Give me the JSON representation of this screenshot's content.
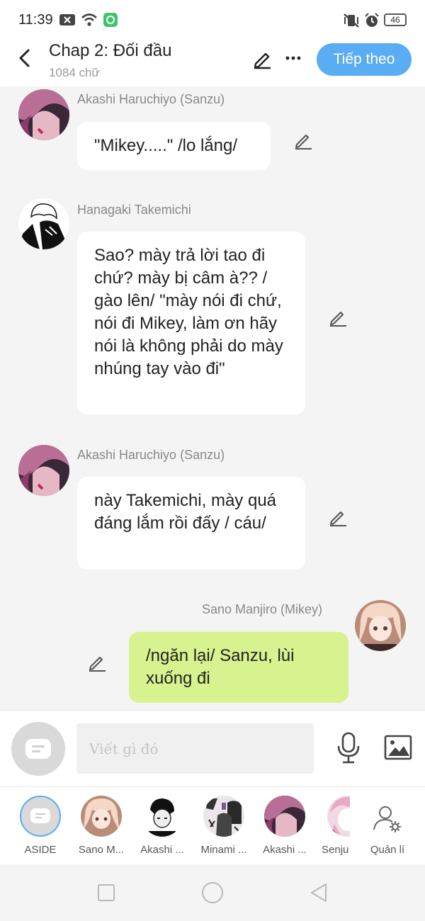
{
  "status": {
    "time": "11:39",
    "battery": "46"
  },
  "header": {
    "title": "Chap 2: Đối đầu",
    "word_count": "1084 chữ",
    "next_label": "Tiếp theo"
  },
  "messages": [
    {
      "sender": "Akashi Haruchiyo (Sanzu)",
      "text": "\"Mikey.....\" /lo lắng/",
      "side": "left"
    },
    {
      "sender": "Hanagaki Takemichi",
      "text": "Sao? mày trả lời tao đi chứ? mày bị câm à?? / gào lên/ \"mày nói đi chứ, nói đi Mikey, làm ơn hãy nói là không phải do mày nhúng tay vào đi\"",
      "side": "left"
    },
    {
      "sender": "Akashi Haruchiyo (Sanzu)",
      "text": "này Takemichi, mày quá đáng lắm rồi đấy / cáu/",
      "side": "left"
    },
    {
      "sender": "Sano Manjiro (Mikey)",
      "text": "/ngăn lại/ Sanzu, lùi xuống đi",
      "side": "right"
    }
  ],
  "composer": {
    "placeholder": "Viết gì đó"
  },
  "characters": [
    {
      "label": "ASIDE"
    },
    {
      "label": "Sano M..."
    },
    {
      "label": "Akashi ..."
    },
    {
      "label": "Minami ..."
    },
    {
      "label": "Akashi ..."
    },
    {
      "label": "Senju"
    },
    {
      "label": "Quản lí"
    }
  ],
  "colors": {
    "accent": "#5aacf3",
    "my_bubble": "#d7f28e",
    "background": "#f4f4f4"
  },
  "icons": [
    "back-icon",
    "edit-icon",
    "more-icon",
    "mic-icon",
    "image-icon",
    "settings-user-icon"
  ]
}
